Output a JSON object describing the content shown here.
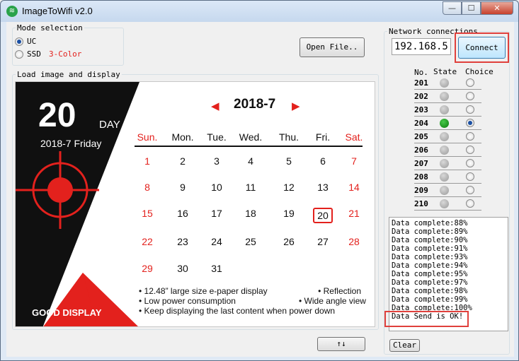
{
  "window": {
    "title": "ImageToWifi v2.0",
    "controls": {
      "minimize": "—",
      "maximize": "☐",
      "close": "✕"
    }
  },
  "mode_selection": {
    "legend": "Mode selection",
    "options": [
      {
        "label": "UC",
        "selected": true
      },
      {
        "label": "SSD",
        "selected": false,
        "extra": "3-Color"
      }
    ]
  },
  "open_file_label": "Open File..",
  "load_legend": "Load image and display",
  "swap_label": "↑↓",
  "network": {
    "legend": "Network connections",
    "ip": "192.168.5.",
    "connect_label": "Connect",
    "headers": {
      "no": "No.",
      "state": "State",
      "choice": "Choice"
    },
    "devices": [
      {
        "no": "201",
        "online": false,
        "chosen": false
      },
      {
        "no": "202",
        "online": false,
        "chosen": false
      },
      {
        "no": "203",
        "online": false,
        "chosen": false
      },
      {
        "no": "204",
        "online": true,
        "chosen": true
      },
      {
        "no": "205",
        "online": false,
        "chosen": false
      },
      {
        "no": "206",
        "online": false,
        "chosen": false
      },
      {
        "no": "207",
        "online": false,
        "chosen": false
      },
      {
        "no": "208",
        "online": false,
        "chosen": false
      },
      {
        "no": "209",
        "online": false,
        "chosen": false
      },
      {
        "no": "210",
        "online": false,
        "chosen": false
      }
    ]
  },
  "log_lines": [
    "Data complete:88%",
    "Data complete:89%",
    "Data complete:90%",
    "Data complete:91%",
    "Data complete:93%",
    "Data complete:94%",
    "Data complete:95%",
    "Data complete:97%",
    "Data complete:98%",
    "Data complete:99%",
    "Data complete:100%",
    "Data Send is OK!"
  ],
  "clear_label": "Clear",
  "calendar_image": {
    "day_number": "20",
    "day_label": "DAY",
    "date_line": "2018-7 Friday",
    "brand": "GOOD DISPLAY",
    "month_title": "2018-7",
    "prev_arrow": "◀",
    "next_arrow": "▶",
    "weekdays": [
      {
        "label": "Sun.",
        "red": true
      },
      {
        "label": "Mon.",
        "red": false
      },
      {
        "label": "Tue.",
        "red": false
      },
      {
        "label": "Wed.",
        "red": false
      },
      {
        "label": "Thu.",
        "red": false
      },
      {
        "label": "Fri.",
        "red": false
      },
      {
        "label": "Sat.",
        "red": true
      }
    ],
    "weeks": [
      [
        "1",
        "2",
        "3",
        "4",
        "5",
        "6",
        "7"
      ],
      [
        "8",
        "9",
        "10",
        "11",
        "12",
        "13",
        "14"
      ],
      [
        "15",
        "16",
        "17",
        "18",
        "19",
        "20",
        "21"
      ],
      [
        "22",
        "23",
        "24",
        "25",
        "26",
        "27",
        "28"
      ],
      [
        "29",
        "30",
        "31",
        "",
        "",
        "",
        ""
      ]
    ],
    "highlight_day": "20",
    "features": [
      {
        "left": "• 12.48” large size e-paper display",
        "right": "• Reflection"
      },
      {
        "left": "• Low power consumption",
        "right": "• Wide angle view"
      },
      {
        "left": "• Keep displaying the last content when power down",
        "right": ""
      }
    ],
    "colors": {
      "red": "#e3211d",
      "black": "#101010"
    }
  }
}
